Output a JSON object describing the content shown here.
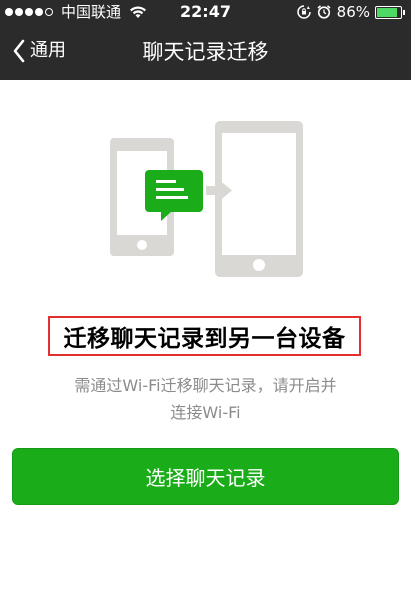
{
  "status_bar": {
    "carrier": "中国联通",
    "time": "22:47",
    "battery": "86%",
    "battery_level": 0.86
  },
  "nav": {
    "back_label": "通用",
    "title": "聊天记录迁移"
  },
  "main": {
    "heading": "迁移聊天记录到另一台设备",
    "description_line1": "需通过Wi-Fi迁移聊天记录，请开启并",
    "description_line2": "连接Wi-Fi",
    "button_label": "选择聊天记录"
  },
  "colors": {
    "bar_background": "#2b2b2b",
    "accent_green": "#1aad19",
    "device_gray": "#dad8d4",
    "highlight_red": "#e03030"
  },
  "icons": [
    "signal-dots-icon",
    "wifi-icon",
    "rotation-lock-icon",
    "alarm-icon",
    "battery-icon",
    "back-chevron-icon",
    "phone-icon",
    "chat-bubble-icon",
    "arrow-right-icon",
    "tablet-icon"
  ]
}
